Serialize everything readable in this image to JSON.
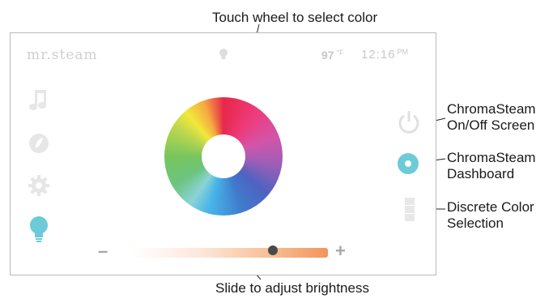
{
  "callouts": {
    "wheel": "Touch wheel to select color",
    "slider": "Slide to adjust brightness",
    "onoff_line1": "ChromaSteam",
    "onoff_line2": "On/Off Screen",
    "dashboard_line1": "ChromaSteam",
    "dashboard_line2": "Dashboard",
    "discrete_line1": "Discrete Color",
    "discrete_line2": "Selection"
  },
  "header": {
    "brand": "mr.steam",
    "temperature": "97",
    "temperature_unit": "°F",
    "time": "12:16",
    "time_suffix": "PM"
  },
  "sidebar": {
    "items": [
      {
        "icon": "music-note-icon"
      },
      {
        "icon": "leaf-icon"
      },
      {
        "icon": "gear-icon"
      },
      {
        "icon": "lightbulb-icon",
        "active": true
      }
    ]
  },
  "brightness": {
    "minus_label": "–",
    "plus_label": "+",
    "level": 0.72
  },
  "colors": {
    "accent": "#6ccbd6",
    "inactive_icon": "#e6e6e6",
    "slider_end": "#f4935c"
  }
}
